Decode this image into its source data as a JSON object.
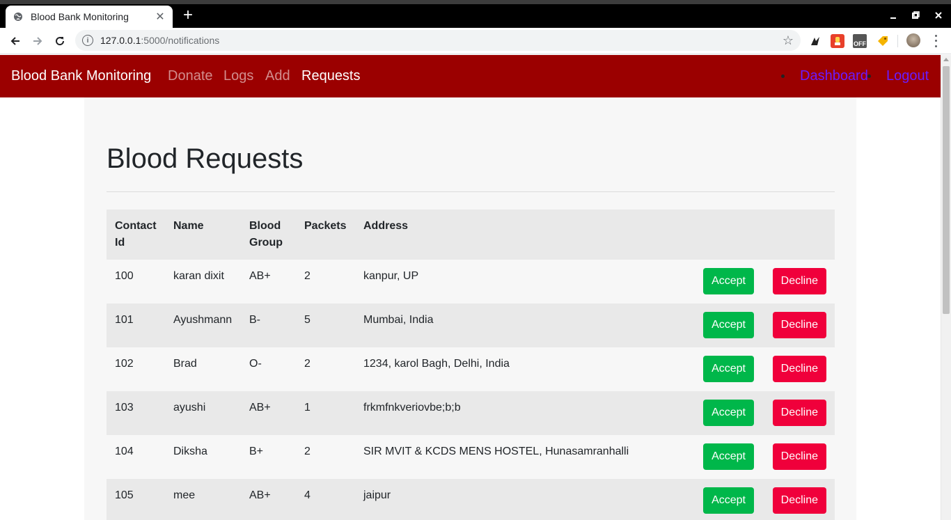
{
  "browser": {
    "tab_title": "Blood Bank Monitoring",
    "url_host": "127.0.0.1",
    "url_path": ":5000/notifications",
    "ext_off_label": "OFF"
  },
  "nav": {
    "brand": "Blood Bank Monitoring",
    "links": [
      "Donate",
      "Logs",
      "Add",
      "Requests"
    ],
    "active": "Requests",
    "right_links": [
      "Dashboard",
      "Logout"
    ]
  },
  "page": {
    "title": "Blood Requests"
  },
  "table": {
    "headers": {
      "contact": "Contact Id",
      "name": "Name",
      "blood": "Blood Group",
      "packets": "Packets",
      "address": "Address"
    },
    "accept_label": "Accept",
    "decline_label": "Decline",
    "rows": [
      {
        "id": "100",
        "name": "karan dixit",
        "group": "AB+",
        "packets": "2",
        "address": "kanpur, UP"
      },
      {
        "id": "101",
        "name": "Ayushmann",
        "group": "B-",
        "packets": "5",
        "address": "Mumbai, India"
      },
      {
        "id": "102",
        "name": "Brad",
        "group": "O-",
        "packets": "2",
        "address": "1234, karol Bagh, Delhi, India"
      },
      {
        "id": "103",
        "name": "ayushi",
        "group": "AB+",
        "packets": "1",
        "address": "frkmfnkveriovbe;b;b"
      },
      {
        "id": "104",
        "name": "Diksha",
        "group": "B+",
        "packets": "2",
        "address": "SIR MVIT & KCDS MENS HOSTEL, Hunasamranhalli"
      },
      {
        "id": "105",
        "name": "mee",
        "group": "AB+",
        "packets": "4",
        "address": "jaipur"
      }
    ]
  },
  "colors": {
    "navbar": "#9b0000",
    "accept": "#00b74a",
    "decline": "#f0003b",
    "right_link": "#6a1cff"
  }
}
